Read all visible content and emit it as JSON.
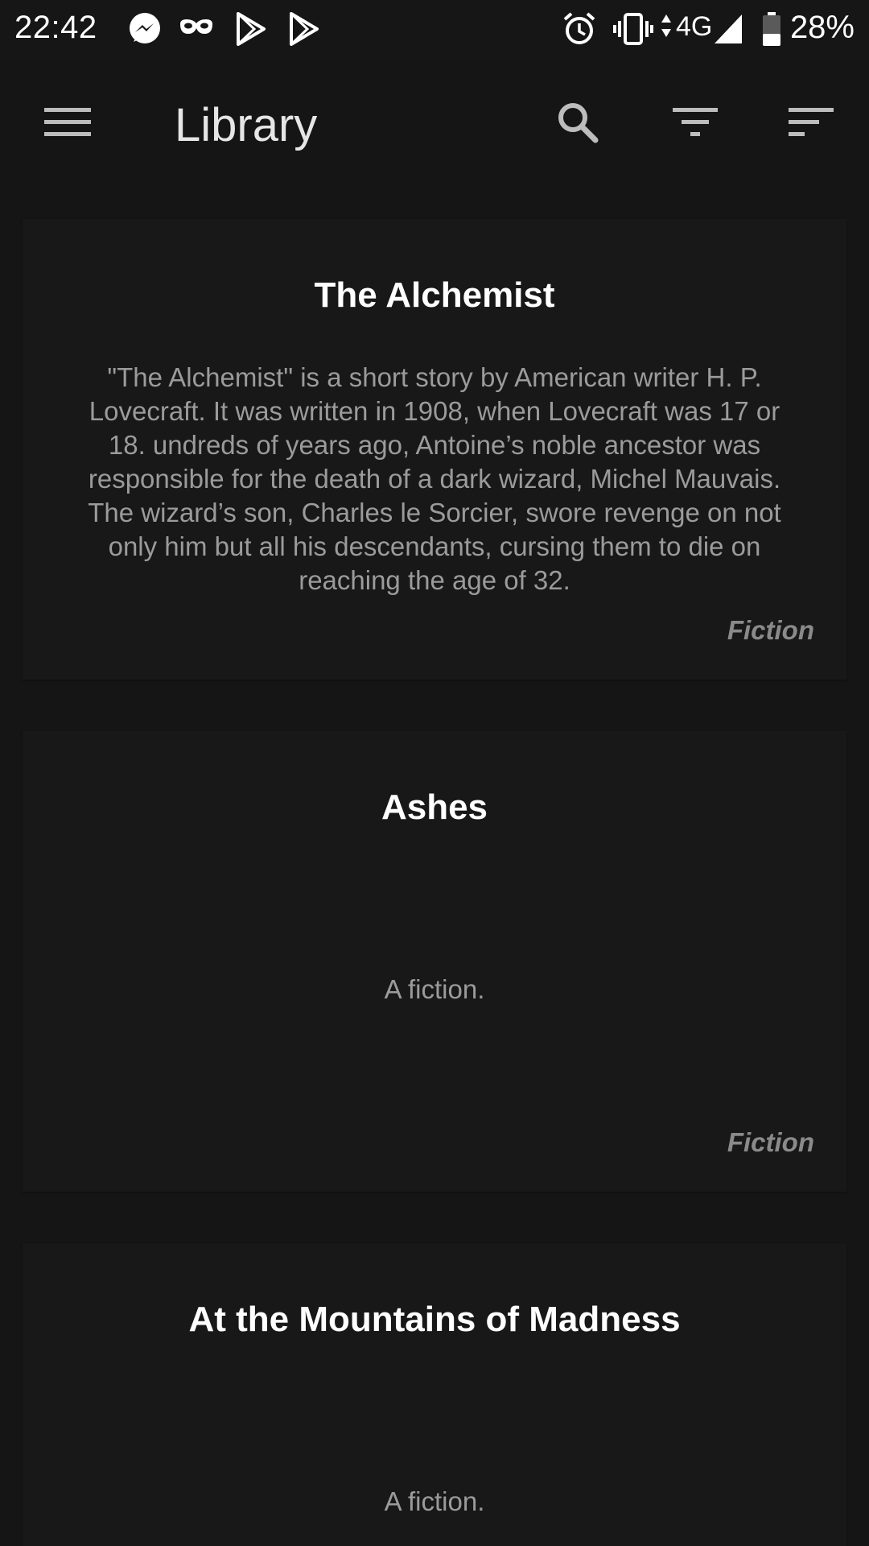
{
  "status_bar": {
    "time": "22:42",
    "network": "4G",
    "battery": "28%",
    "notification_icons": [
      "messenger-icon",
      "incognito-icon",
      "play-store-icon",
      "play-store-icon"
    ],
    "system_icons": [
      "alarm-icon",
      "vibrate-icon",
      "data-arrows-icon",
      "signal-icon",
      "battery-icon"
    ]
  },
  "app_bar": {
    "title": "Library",
    "actions": [
      "search-icon",
      "filter-icon",
      "sort-icon"
    ]
  },
  "books": [
    {
      "title": "The Alchemist",
      "description": "\"The Alchemist\" is a short story by American writer H. P. Lovecraft. It was written in 1908, when Lovecraft was 17 or 18. undreds of years ago, Antoine’s noble ancestor was responsible for the death of a dark wizard, Michel Mauvais. The wizard’s son, Charles le Sorcier, swore revenge on not only him but all his descendants, cursing them to die on reaching the age of 32.",
      "genre": "Fiction"
    },
    {
      "title": "Ashes",
      "description": "A fiction.",
      "genre": "Fiction"
    },
    {
      "title": "At the Mountains of Madness",
      "description": "A fiction.",
      "genre": ""
    }
  ],
  "colors": {
    "background": "#151515",
    "card": "#181818",
    "title": "#ffffff",
    "description": "#9b9b9b",
    "genre": "#8a8a8a"
  }
}
